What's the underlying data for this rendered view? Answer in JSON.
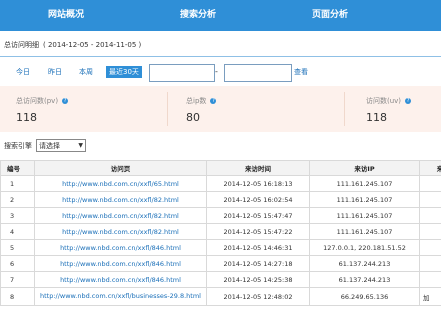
{
  "nav": {
    "tabs": [
      "网站概况",
      "搜索分析",
      "页面分析"
    ]
  },
  "page": {
    "title": "总访问明细",
    "date_range": "( 2014-12-05 - 2014-11-05 )"
  },
  "quick_range": {
    "buttons": [
      "今日",
      "昨日",
      "本周",
      "最近30天"
    ],
    "active": "最近30天",
    "start_date": "",
    "end_date": "",
    "separator": "-",
    "query_label": "查看"
  },
  "stats": [
    {
      "label": "总访问数(pv)",
      "value": "118"
    },
    {
      "label": "总ip数",
      "value": "80"
    },
    {
      "label": "访问数(uv)",
      "value": "118"
    }
  ],
  "filter": {
    "label": "搜索引擎",
    "selected": "请选择"
  },
  "table": {
    "headers": [
      "编号",
      "访问页",
      "来访时间",
      "来访IP",
      "来"
    ],
    "rows": [
      {
        "no": "1",
        "page": "http://www.nbd.com.cn/xxfl/65.html",
        "time": "2014-12-05 16:18:13",
        "ip": "111.161.245.107",
        "extra": ""
      },
      {
        "no": "2",
        "page": "http://www.nbd.com.cn/xxfl/82.html",
        "time": "2014-12-05 16:02:54",
        "ip": "111.161.245.107",
        "extra": ""
      },
      {
        "no": "3",
        "page": "http://www.nbd.com.cn/xxfl/82.html",
        "time": "2014-12-05 15:47:47",
        "ip": "111.161.245.107",
        "extra": ""
      },
      {
        "no": "4",
        "page": "http://www.nbd.com.cn/xxfl/82.html",
        "time": "2014-12-05 15:47:22",
        "ip": "111.161.245.107",
        "extra": ""
      },
      {
        "no": "5",
        "page": "http://www.nbd.com.cn/xxfl/846.html",
        "time": "2014-12-05 14:46:31",
        "ip": "127.0.0.1, 220.181.51.52",
        "extra": ""
      },
      {
        "no": "6",
        "page": "http://www.nbd.com.cn/xxfl/846.html",
        "time": "2014-12-05 14:27:18",
        "ip": "61.137.244.213",
        "extra": ""
      },
      {
        "no": "7",
        "page": "http://www.nbd.com.cn/xxfl/846.html",
        "time": "2014-12-05 14:25:38",
        "ip": "61.137.244.213",
        "extra": ""
      },
      {
        "no": "8",
        "page": "http://www.nbd.com.cn/xxfl/businesses-29.8.html",
        "time": "2014-12-05 12:48:02",
        "ip": "66.249.65.136",
        "extra": "加"
      }
    ]
  }
}
